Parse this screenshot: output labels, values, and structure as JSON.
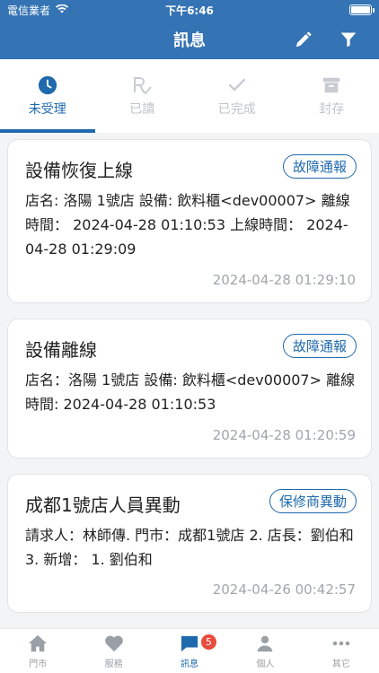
{
  "status": {
    "carrier": "電信業者",
    "time": "下午6:46"
  },
  "header": {
    "title": "訊息",
    "icons": [
      "edit-icon",
      "filter-icon"
    ]
  },
  "tabs": [
    {
      "label": "未受理",
      "icon": "clock-icon",
      "active": true
    },
    {
      "label": "已讀",
      "icon": "read-icon",
      "active": false
    },
    {
      "label": "已完成",
      "icon": "check-icon",
      "active": false
    },
    {
      "label": "封存",
      "icon": "archive-icon",
      "active": false
    }
  ],
  "cards": [
    {
      "title": "設備恢復上線",
      "badge": "故障通報",
      "body": "店名: 洛陽 1號店 設備: 飲料櫃<dev00007> 離線時間： 2024-04-28 01:10:53 上線時間： 2024-04-28 01:29:09",
      "time": "2024-04-28 01:29:10"
    },
    {
      "title": "設備離線",
      "badge": "故障通報",
      "body": "店名：洛陽 1號店 設備: 飲料櫃<dev00007> 離線時間: 2024-04-28 01:10:53",
      "time": "2024-04-28 01:20:59"
    },
    {
      "title": "成都1號店人員異動",
      "badge": "保修商異動",
      "body": "請求人：林師傳. 門市：成都1號店 2. 店長：劉伯和 3. 新增： 1. 劉伯和",
      "time": "2024-04-26 00:42:57"
    }
  ],
  "bottom_nav": [
    {
      "label": "門市",
      "icon": "store-icon",
      "active": false
    },
    {
      "label": "服務",
      "icon": "heart-icon",
      "active": false
    },
    {
      "label": "訊息",
      "icon": "message-icon",
      "active": true,
      "badge": "5"
    },
    {
      "label": "個人",
      "icon": "person-icon",
      "active": false
    },
    {
      "label": "其它",
      "icon": "more-icon",
      "active": false
    }
  ],
  "colors": {
    "primary": "#3473b4",
    "accent": "#1f69ad",
    "badge": "#e74c3c"
  }
}
